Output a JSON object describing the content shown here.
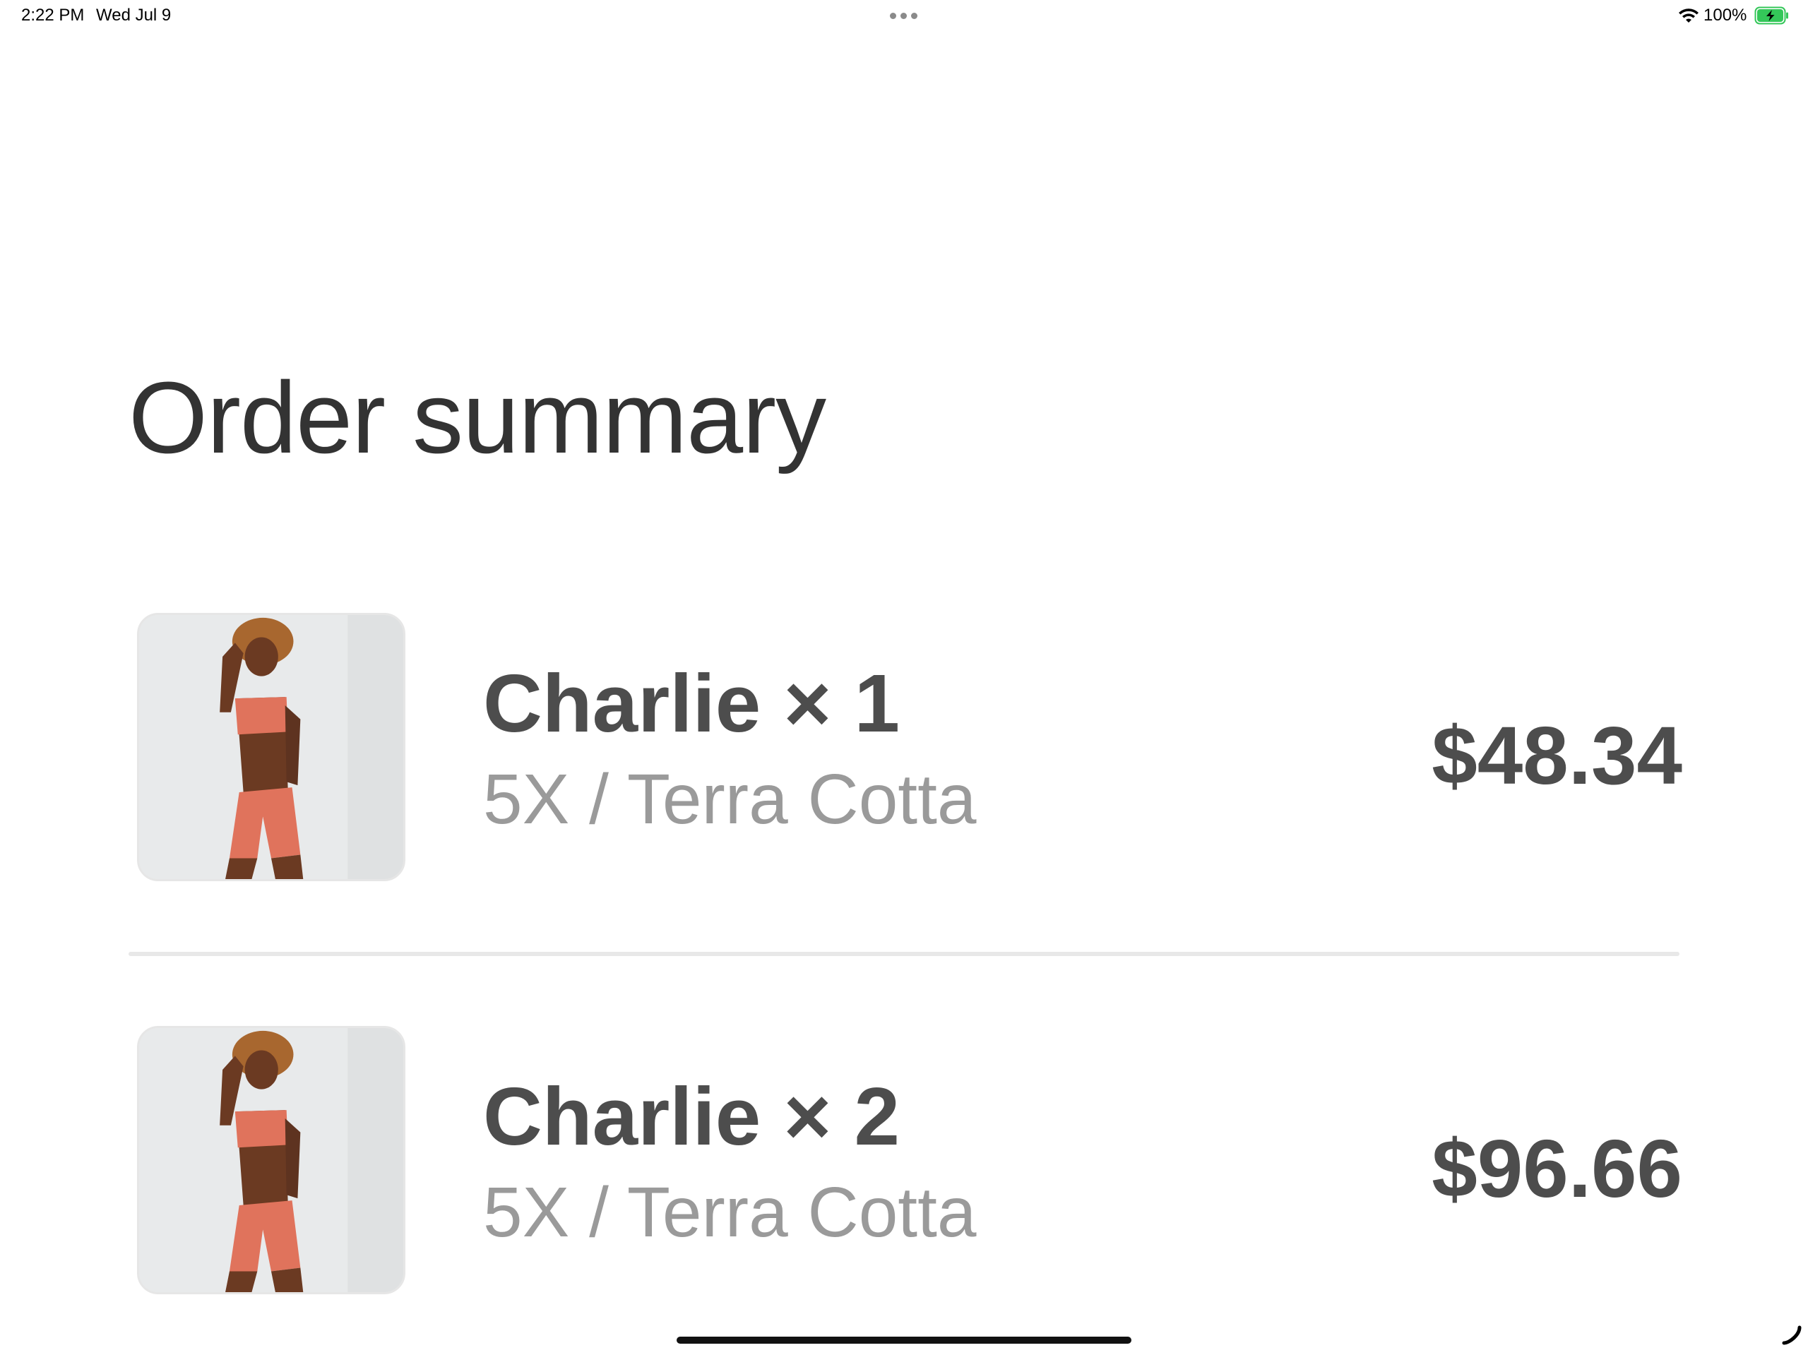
{
  "status_bar": {
    "time": "2:22 PM",
    "date": "Wed Jul 9",
    "battery_percent": "100%",
    "battery_level": 1.0,
    "battery_charging": true
  },
  "order_summary": {
    "title": "Order summary",
    "items": [
      {
        "name": "Charlie × 1",
        "variant": "5X / Terra Cotta",
        "price": "$48.34",
        "thumbnail": "product-photo-terra-cotta-set"
      },
      {
        "name": "Charlie × 2",
        "variant": "5X / Terra Cotta",
        "price": "$96.66",
        "thumbnail": "product-photo-terra-cotta-set"
      }
    ]
  },
  "colors": {
    "title_text": "#333333",
    "item_text": "#4d4d4d",
    "variant_text": "#9a9a9a",
    "product_color": "#e0735c",
    "battery_green": "#34c759"
  }
}
